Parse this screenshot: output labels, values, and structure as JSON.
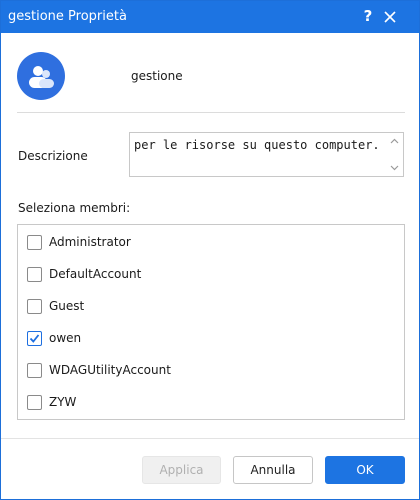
{
  "window": {
    "title": "gestione Proprietà",
    "help_label": "?",
    "accent_color": "#1d74e2"
  },
  "group": {
    "name": "gestione",
    "icon": "users-icon"
  },
  "description": {
    "label": "Descrizione",
    "value": "per le risorse su questo computer."
  },
  "members": {
    "label": "Seleziona membri:",
    "items": [
      {
        "name": "Administrator",
        "checked": false
      },
      {
        "name": "DefaultAccount",
        "checked": false
      },
      {
        "name": "Guest",
        "checked": false
      },
      {
        "name": "owen",
        "checked": true
      },
      {
        "name": "WDAGUtilityAccount",
        "checked": false
      },
      {
        "name": "ZYW",
        "checked": false
      }
    ]
  },
  "buttons": {
    "apply": "Applica",
    "cancel": "Annulla",
    "ok": "OK"
  }
}
